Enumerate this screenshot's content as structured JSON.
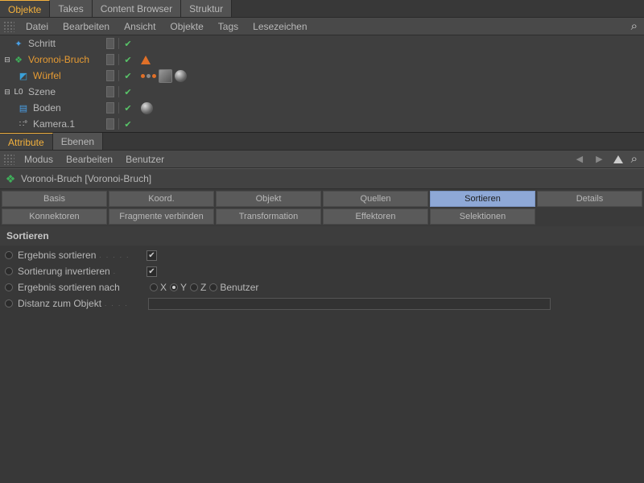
{
  "top_tabs": {
    "t0": "Objekte",
    "t1": "Takes",
    "t2": "Content Browser",
    "t3": "Struktur"
  },
  "obj_menu": {
    "m0": "Datei",
    "m1": "Bearbeiten",
    "m2": "Ansicht",
    "m3": "Objekte",
    "m4": "Tags",
    "m5": "Lesezeichen"
  },
  "tree": {
    "r0": "Schritt",
    "r1": "Voronoi-Bruch",
    "r2": "Würfel",
    "r3": "Szene",
    "r4": "Boden",
    "r5": "Kamera.1"
  },
  "attr_tabs": {
    "t0": "Attribute",
    "t1": "Ebenen"
  },
  "attr_menu": {
    "m0": "Modus",
    "m1": "Bearbeiten",
    "m2": "Benutzer"
  },
  "obj_title": "Voronoi-Bruch [Voronoi-Bruch]",
  "prop_tabs": {
    "r0c0": "Basis",
    "r0c1": "Koord.",
    "r0c2": "Objekt",
    "r0c3": "Quellen",
    "r0c4": "Sortieren",
    "r0c5": "Details",
    "r1c0": "Konnektoren",
    "r1c1": "Fragmente verbinden",
    "r1c2": "Transformation",
    "r1c3": "Effektoren",
    "r1c4": "Selektionen"
  },
  "section": "Sortieren",
  "params": {
    "p0": "Ergebnis sortieren",
    "p1": "Sortierung invertieren",
    "p2": "Ergebnis sortieren nach",
    "p3": "Distanz zum Objekt",
    "ax_x": "X",
    "ax_y": "Y",
    "ax_z": "Z",
    "ax_user": "Benutzer"
  }
}
